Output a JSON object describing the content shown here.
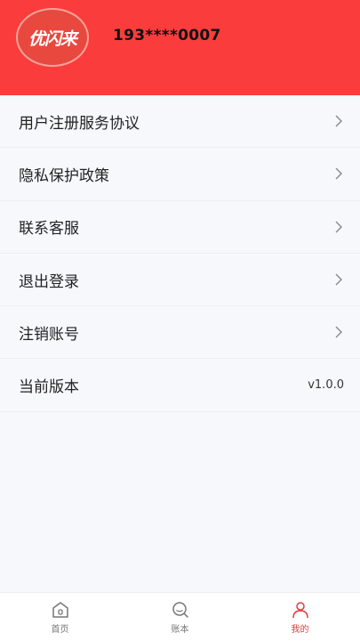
{
  "header": {
    "logo_text": "优闪来",
    "phone": "193****0007",
    "bg_color": "#fb3c3c"
  },
  "menu": {
    "items": [
      {
        "label": "用户注册服务协议",
        "icon": "chevron-right-icon"
      },
      {
        "label": "隐私保护政策",
        "icon": "chevron-right-icon"
      },
      {
        "label": "联系客服",
        "icon": "chevron-right-icon"
      },
      {
        "label": "退出登录",
        "icon": "chevron-right-icon"
      },
      {
        "label": "注销账号",
        "icon": "chevron-right-icon"
      }
    ],
    "version": {
      "label": "当前版本",
      "value": "v1.0.0"
    }
  },
  "tabbar": {
    "tabs": [
      {
        "label": "首页",
        "icon": "home-icon",
        "active": false
      },
      {
        "label": "账本",
        "icon": "search-icon",
        "active": false
      },
      {
        "label": "我的",
        "icon": "user-icon",
        "active": true
      }
    ],
    "active_color": "#e23c3c"
  }
}
